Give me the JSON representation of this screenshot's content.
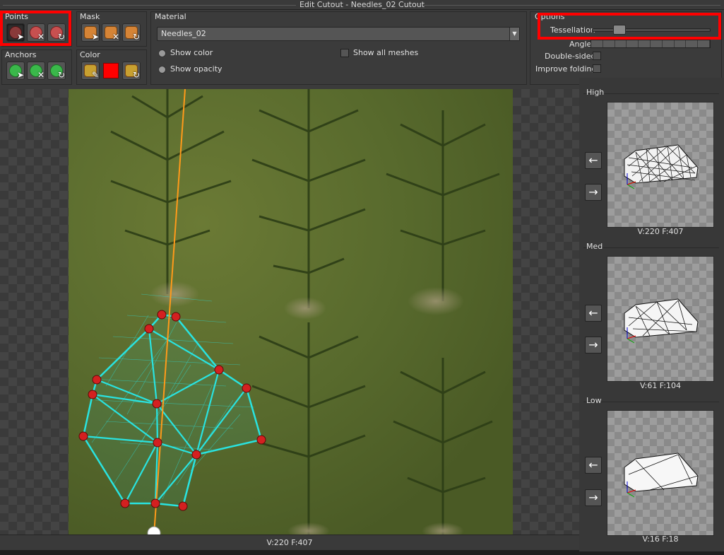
{
  "window": {
    "title": "Edit Cutout - Needles_02 Cutout"
  },
  "groups": {
    "points": {
      "label": "Points"
    },
    "mask": {
      "label": "Mask"
    },
    "anchors": {
      "label": "Anchors"
    },
    "color": {
      "label": "Color",
      "swatch": "#ff0000"
    },
    "material": {
      "label": "Material",
      "selected": "Needles_02",
      "show_color": "Show color",
      "show_opacity": "Show opacity",
      "show_all_meshes": "Show all  meshes"
    },
    "options": {
      "label": "Options",
      "tessellation": "Tessellation",
      "tessellation_value": 0.2,
      "angle": "Angle",
      "double_sided": "Double-sided",
      "improve_folding": "Improve folding"
    }
  },
  "viewport": {
    "status": "V:220  F:407"
  },
  "lod": [
    {
      "name": "High",
      "stats": "V:220  F:407"
    },
    {
      "name": "Med",
      "stats": "V:61  F:104"
    },
    {
      "name": "Low",
      "stats": "V:16  F:18"
    }
  ],
  "colors": {
    "highlight": "#ff0000",
    "mesh": "#29e3e0",
    "axis": "#ff9a1a",
    "point": "#d42020"
  }
}
